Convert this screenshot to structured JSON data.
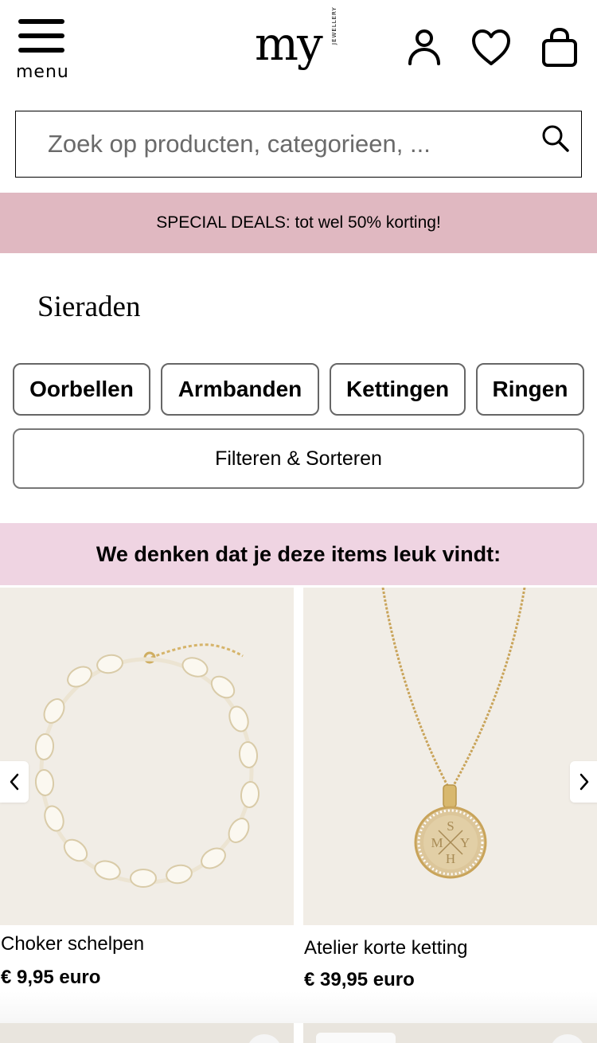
{
  "header": {
    "menu_label": "menu",
    "logo_text": "my",
    "logo_sub": "JEWELLERY",
    "icons": [
      "account-icon",
      "heart-icon",
      "shopping-bag-icon"
    ]
  },
  "search": {
    "placeholder": "Zoek op producten, categorieen, ...",
    "icon": "search-icon"
  },
  "deals_banner": "SPECIAL DEALS: tot wel 50% korting!",
  "page_title": "Sieraden",
  "categories": [
    "Oorbellen",
    "Armbanden",
    "Kettingen",
    "Ringen"
  ],
  "filter_label": "Filteren & Sorteren",
  "recommendations": {
    "heading": "We denken dat je deze items leuk vindt:",
    "items": [
      {
        "name": "Choker schelpen",
        "price": "€ 9,95 euro"
      },
      {
        "name": "Atelier korte ketting",
        "price": "€ 39,95 euro",
        "engraving": [
          "S",
          "M",
          "Y",
          "H"
        ]
      }
    ],
    "prev_icon": "chevron-left-icon",
    "next_icon": "chevron-right-icon"
  },
  "colors": {
    "deals_bg": "#e0b8c1",
    "reco_bg": "#efd4e2",
    "product_bg": "#f1ede6",
    "gold": "#c9a45a"
  }
}
